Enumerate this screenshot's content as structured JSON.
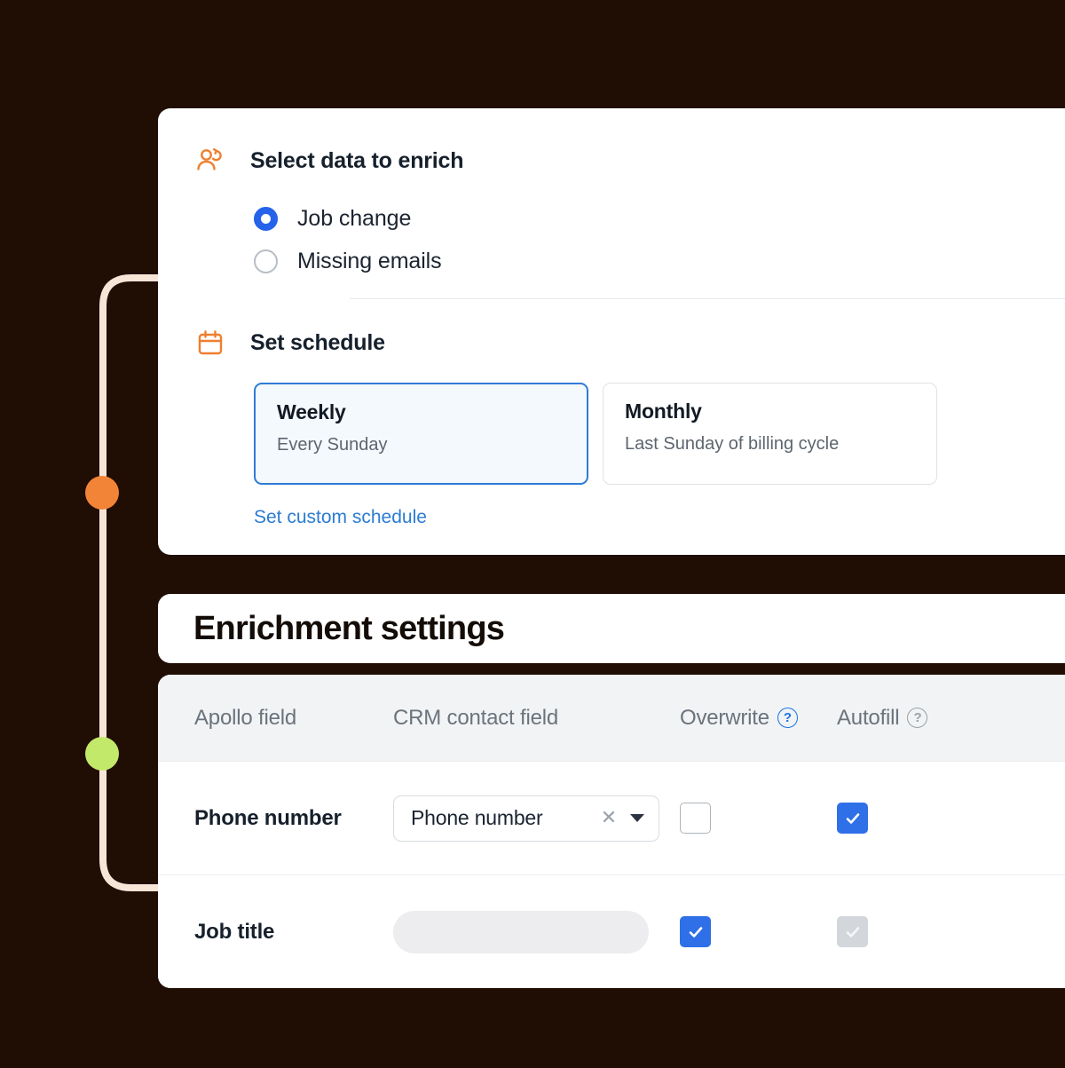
{
  "theme": {
    "background": "#200d03",
    "connector_line": "#f7e6d8",
    "dot_orange": "#f28438",
    "dot_green": "#c3e96a",
    "accent_blue": "#2f6fe8",
    "link_blue": "#2b7cd3",
    "icon_orange": "#ef7f2e"
  },
  "schedule_card": {
    "select_data": {
      "icon": "person-sync-icon",
      "title": "Select data to enrich",
      "options": [
        {
          "label": "Job change",
          "selected": true
        },
        {
          "label": "Missing emails",
          "selected": false
        }
      ]
    },
    "set_schedule": {
      "icon": "calendar-icon",
      "title": "Set schedule",
      "options": [
        {
          "name": "Weekly",
          "description": "Every Sunday",
          "selected": true
        },
        {
          "name": "Monthly",
          "description": "Last Sunday of billing cycle",
          "selected": false
        }
      ],
      "custom_link": "Set custom schedule"
    }
  },
  "enrichment": {
    "title": "Enrichment settings",
    "columns": [
      {
        "label": "Apollo field",
        "help": false
      },
      {
        "label": "CRM contact field",
        "help": false
      },
      {
        "label": "Overwrite",
        "help": true,
        "help_active": true
      },
      {
        "label": "Autofill",
        "help": true,
        "help_active": false
      }
    ],
    "rows": [
      {
        "apollo_field": "Phone number",
        "crm_field_type": "select",
        "crm_field_value": "Phone number",
        "overwrite": "unchecked",
        "autofill": "checked"
      },
      {
        "apollo_field": "Job title",
        "crm_field_type": "skeleton",
        "crm_field_value": "",
        "overwrite": "checked",
        "autofill": "disabled-checked"
      }
    ]
  }
}
